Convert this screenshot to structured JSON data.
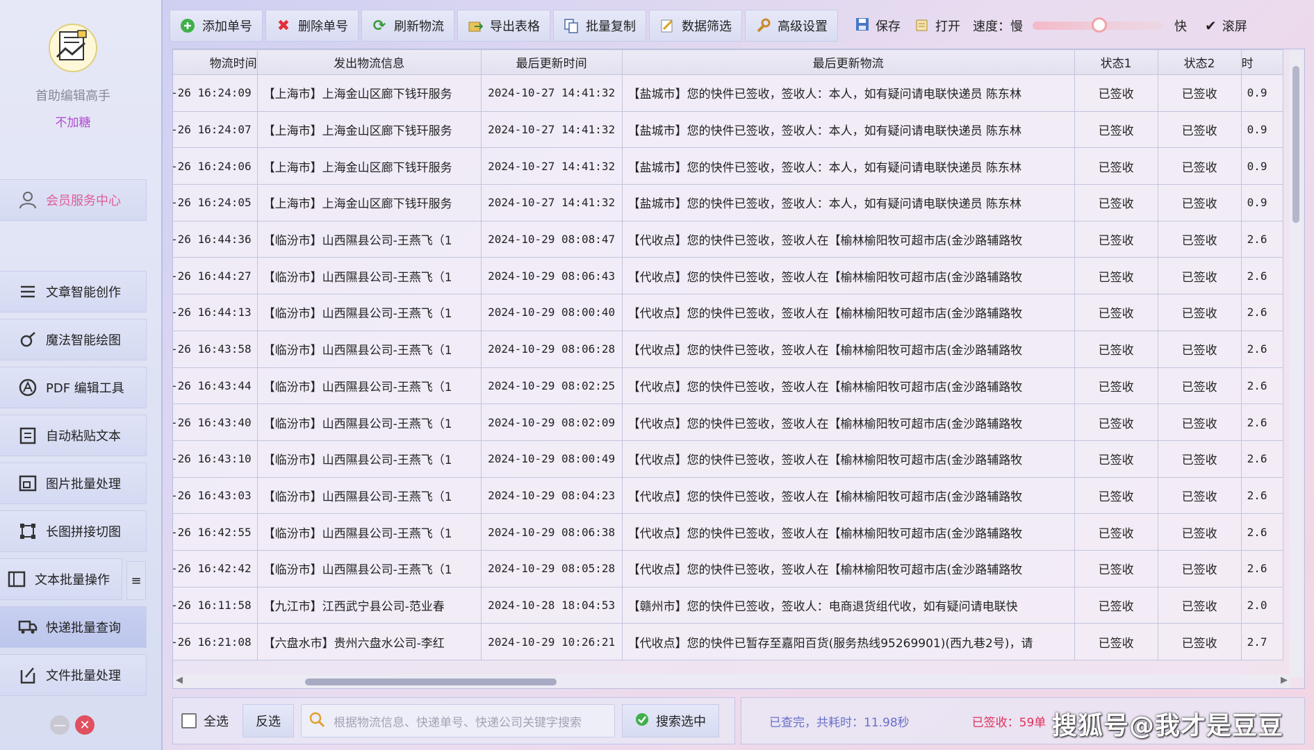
{
  "sidebar": {
    "app_name": "首助编辑高手",
    "app_sub": "不加糖",
    "member_label": "会员服务中心",
    "items": [
      {
        "label": "文章智能创作",
        "icon": "list-icon"
      },
      {
        "label": "魔法智能绘图",
        "icon": "brush-icon"
      },
      {
        "label": "PDF 编辑工具",
        "icon": "pdf-icon"
      },
      {
        "label": "自动粘贴文本",
        "icon": "clipboard-icon"
      },
      {
        "label": "图片批量处理",
        "icon": "image-icon"
      },
      {
        "label": "长图拼接切图",
        "icon": "crop-icon"
      },
      {
        "label": "文本批量操作",
        "icon": "text-icon"
      },
      {
        "label": "快递批量查询",
        "icon": "truck-icon"
      },
      {
        "label": "文件批量处理",
        "icon": "file-icon"
      }
    ]
  },
  "toolbar": {
    "add_label": "添加单号",
    "delete_label": "删除单号",
    "refresh_label": "刷新物流",
    "export_label": "导出表格",
    "copy_label": "批量复制",
    "filter_label": "数据筛选",
    "advanced_label": "高级设置",
    "save_label": "保存",
    "open_label": "打开",
    "speed_label": "速度：慢",
    "speed_fast": "快",
    "speed_value": 0.45,
    "scroll_label": "滚屏"
  },
  "table": {
    "columns": [
      "物流时间",
      "发出物流信息",
      "最后更新时间",
      "最后更新物流",
      "状态1",
      "状态2",
      "时"
    ],
    "rows": [
      [
        "-26 16:24:09",
        "【上海市】上海金山区廊下钱玕服务",
        "2024-10-27 14:41:32",
        "【盐城市】您的快件已签收，签收人：本人，如有疑问请电联快递员 陈东林",
        "已签收",
        "已签收",
        "0.9"
      ],
      [
        "-26 16:24:07",
        "【上海市】上海金山区廊下钱玕服务",
        "2024-10-27 14:41:32",
        "【盐城市】您的快件已签收，签收人：本人，如有疑问请电联快递员 陈东林",
        "已签收",
        "已签收",
        "0.9"
      ],
      [
        "-26 16:24:06",
        "【上海市】上海金山区廊下钱玕服务",
        "2024-10-27 14:41:32",
        "【盐城市】您的快件已签收，签收人：本人，如有疑问请电联快递员 陈东林",
        "已签收",
        "已签收",
        "0.9"
      ],
      [
        "-26 16:24:05",
        "【上海市】上海金山区廊下钱玕服务",
        "2024-10-27 14:41:32",
        "【盐城市】您的快件已签收，签收人：本人，如有疑问请电联快递员 陈东林",
        "已签收",
        "已签收",
        "0.9"
      ],
      [
        "-26 16:44:36",
        "【临汾市】山西隰县公司-王燕飞（1",
        "2024-10-29 08:08:47",
        "【代收点】您的快件已签收，签收人在【榆林榆阳牧可超市店(金沙路辅路牧",
        "已签收",
        "已签收",
        "2.6"
      ],
      [
        "-26 16:44:27",
        "【临汾市】山西隰县公司-王燕飞（1",
        "2024-10-29 08:06:43",
        "【代收点】您的快件已签收，签收人在【榆林榆阳牧可超市店(金沙路辅路牧",
        "已签收",
        "已签收",
        "2.6"
      ],
      [
        "-26 16:44:13",
        "【临汾市】山西隰县公司-王燕飞（1",
        "2024-10-29 08:00:40",
        "【代收点】您的快件已签收，签收人在【榆林榆阳牧可超市店(金沙路辅路牧",
        "已签收",
        "已签收",
        "2.6"
      ],
      [
        "-26 16:43:58",
        "【临汾市】山西隰县公司-王燕飞（1",
        "2024-10-29 08:06:28",
        "【代收点】您的快件已签收，签收人在【榆林榆阳牧可超市店(金沙路辅路牧",
        "已签收",
        "已签收",
        "2.6"
      ],
      [
        "-26 16:43:44",
        "【临汾市】山西隰县公司-王燕飞（1",
        "2024-10-29 08:02:25",
        "【代收点】您的快件已签收，签收人在【榆林榆阳牧可超市店(金沙路辅路牧",
        "已签收",
        "已签收",
        "2.6"
      ],
      [
        "-26 16:43:40",
        "【临汾市】山西隰县公司-王燕飞（1",
        "2024-10-29 08:02:09",
        "【代收点】您的快件已签收，签收人在【榆林榆阳牧可超市店(金沙路辅路牧",
        "已签收",
        "已签收",
        "2.6"
      ],
      [
        "-26 16:43:10",
        "【临汾市】山西隰县公司-王燕飞（1",
        "2024-10-29 08:00:49",
        "【代收点】您的快件已签收，签收人在【榆林榆阳牧可超市店(金沙路辅路牧",
        "已签收",
        "已签收",
        "2.6"
      ],
      [
        "-26 16:43:03",
        "【临汾市】山西隰县公司-王燕飞（1",
        "2024-10-29 08:04:23",
        "【代收点】您的快件已签收，签收人在【榆林榆阳牧可超市店(金沙路辅路牧",
        "已签收",
        "已签收",
        "2.6"
      ],
      [
        "-26 16:42:55",
        "【临汾市】山西隰县公司-王燕飞（1",
        "2024-10-29 08:06:38",
        "【代收点】您的快件已签收，签收人在【榆林榆阳牧可超市店(金沙路辅路牧",
        "已签收",
        "已签收",
        "2.6"
      ],
      [
        "-26 16:42:42",
        "【临汾市】山西隰县公司-王燕飞（1",
        "2024-10-29 08:05:28",
        "【代收点】您的快件已签收，签收人在【榆林榆阳牧可超市店(金沙路辅路牧",
        "已签收",
        "已签收",
        "2.6"
      ],
      [
        "-26 16:11:58",
        "【九江市】江西武宁县公司-范业春",
        "2024-10-28 18:04:53",
        "【赣州市】您的快件已签收，签收人：电商退货组代收，如有疑问请电联快",
        "已签收",
        "已签收",
        "2.0"
      ],
      [
        "-26 16:21:08",
        "【六盘水市】贵州六盘水公司-李红",
        "2024-10-29 10:26:21",
        "【代收点】您的快件已暂存至嘉阳百货(服务热线95269901)(西九巷2号)，请",
        "已签收",
        "已签收",
        "2.7"
      ]
    ]
  },
  "bottom": {
    "select_all": "全选",
    "invert": "反选",
    "search_placeholder": "根据物流信息、快递单号、快递公司关键字搜索",
    "search_selected": "搜索选中",
    "status_done": "已查完，共耗时：11.98秒",
    "signed_count": "已签收：59单"
  },
  "watermark": "搜狐号@我才是豆豆",
  "colors": {
    "accent_pink": "#e0569a",
    "signed_red": "#e0305a",
    "status_blue": "#6870c8"
  }
}
